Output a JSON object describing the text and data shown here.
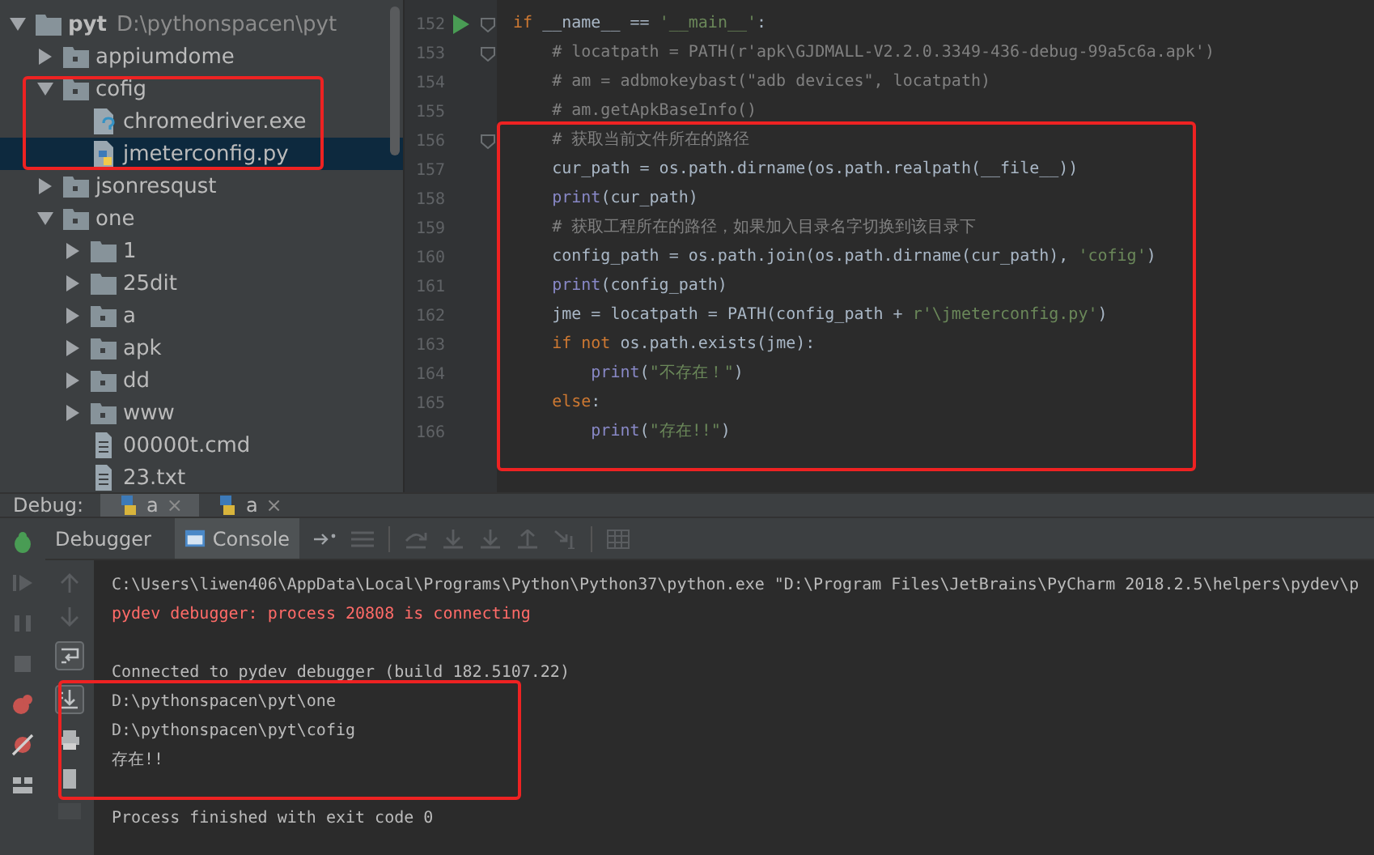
{
  "project_tree": {
    "items": [
      {
        "kind": "folder",
        "label": "pyt",
        "path": "D:\\pythonspacen\\pyt",
        "expanded": true,
        "selected": false,
        "children": [
          {
            "kind": "package",
            "label": "appiumdome",
            "expanded": false,
            "selected": false
          },
          {
            "kind": "package",
            "label": "cofig",
            "expanded": true,
            "selected": false,
            "children": [
              {
                "kind": "file-unknown",
                "label": "chromedriver.exe",
                "selected": false
              },
              {
                "kind": "file-python",
                "label": "jmeterconfig.py",
                "selected": true
              }
            ]
          },
          {
            "kind": "package",
            "label": "jsonresqust",
            "expanded": false,
            "selected": false
          },
          {
            "kind": "package",
            "label": "one",
            "expanded": true,
            "selected": false,
            "children": [
              {
                "kind": "folder",
                "label": "1",
                "expanded": false,
                "selected": false
              },
              {
                "kind": "folder",
                "label": "25dit",
                "expanded": false,
                "selected": false
              },
              {
                "kind": "package",
                "label": "a",
                "expanded": false,
                "selected": false
              },
              {
                "kind": "package",
                "label": "apk",
                "expanded": false,
                "selected": false
              },
              {
                "kind": "package",
                "label": "dd",
                "expanded": false,
                "selected": false
              },
              {
                "kind": "package",
                "label": "www",
                "expanded": false,
                "selected": false
              },
              {
                "kind": "file-text",
                "label": "00000t.cmd",
                "selected": false
              },
              {
                "kind": "file-text",
                "label": "23.txt",
                "selected": false
              }
            ]
          }
        ]
      }
    ]
  },
  "editor": {
    "lines": [
      {
        "number": "152",
        "run_marker": true,
        "fold": true,
        "tokens": [
          {
            "kind": "keyword",
            "text": "if"
          },
          {
            "kind": "plain",
            "text": " __name__ == "
          },
          {
            "kind": "string",
            "text": "'__main__'"
          },
          {
            "kind": "plain",
            "text": ":"
          }
        ]
      },
      {
        "number": "153",
        "run_marker": false,
        "fold": true,
        "tokens": [
          {
            "kind": "comment",
            "text": "    # locatpath = PATH(r'apk\\GJDMALL-V2.2.0.3349-436-debug-99a5c6a.apk')"
          }
        ]
      },
      {
        "number": "154",
        "run_marker": false,
        "fold": false,
        "tokens": [
          {
            "kind": "comment",
            "text": "    # am = adbmokeybast(\"adb devices\", locatpath)"
          }
        ]
      },
      {
        "number": "155",
        "run_marker": false,
        "fold": false,
        "tokens": [
          {
            "kind": "comment",
            "text": "    # am.getApkBaseInfo()"
          }
        ]
      },
      {
        "number": "156",
        "run_marker": false,
        "fold": true,
        "tokens": [
          {
            "kind": "comment",
            "text": "    # 获取当前文件所在的路径"
          }
        ]
      },
      {
        "number": "157",
        "run_marker": false,
        "fold": false,
        "tokens": [
          {
            "kind": "plain",
            "text": "    cur_path = os.path.dirname(os.path.realpath(__file__))"
          }
        ]
      },
      {
        "number": "158",
        "run_marker": false,
        "fold": false,
        "tokens": [
          {
            "kind": "builtin",
            "text": "    print"
          },
          {
            "kind": "plain",
            "text": "(cur_path)"
          }
        ]
      },
      {
        "number": "159",
        "run_marker": false,
        "fold": false,
        "tokens": [
          {
            "kind": "comment",
            "text": "    # 获取工程所在的路径，如果加入目录名字切换到该目录下"
          }
        ]
      },
      {
        "number": "160",
        "run_marker": false,
        "fold": false,
        "tokens": [
          {
            "kind": "plain",
            "text": "    config_path = os.path.join(os.path.dirname(cur_path), "
          },
          {
            "kind": "string",
            "text": "'cofig'"
          },
          {
            "kind": "plain",
            "text": ")"
          }
        ]
      },
      {
        "number": "161",
        "run_marker": false,
        "fold": false,
        "tokens": [
          {
            "kind": "builtin",
            "text": "    print"
          },
          {
            "kind": "plain",
            "text": "(config_path)"
          }
        ]
      },
      {
        "number": "162",
        "run_marker": false,
        "fold": false,
        "tokens": [
          {
            "kind": "plain",
            "text": "    jme = locatpath = PATH(config_path + "
          },
          {
            "kind": "string",
            "text": "r'\\jmeterconfig.py'"
          },
          {
            "kind": "plain",
            "text": ")"
          }
        ]
      },
      {
        "number": "163",
        "run_marker": false,
        "fold": false,
        "tokens": [
          {
            "kind": "keyword",
            "text": "    if not"
          },
          {
            "kind": "plain",
            "text": " os.path.exists(jme):"
          }
        ]
      },
      {
        "number": "164",
        "run_marker": false,
        "fold": false,
        "tokens": [
          {
            "kind": "builtin",
            "text": "        print"
          },
          {
            "kind": "plain",
            "text": "("
          },
          {
            "kind": "string",
            "text": "\"不存在！\""
          },
          {
            "kind": "plain",
            "text": ")"
          }
        ]
      },
      {
        "number": "165",
        "run_marker": false,
        "fold": false,
        "tokens": [
          {
            "kind": "keyword",
            "text": "    else"
          },
          {
            "kind": "plain",
            "text": ":"
          }
        ]
      },
      {
        "number": "166",
        "run_marker": false,
        "fold": false,
        "tokens": [
          {
            "kind": "builtin",
            "text": "        print"
          },
          {
            "kind": "plain",
            "text": "("
          },
          {
            "kind": "string",
            "text": "\"存在!!\""
          },
          {
            "kind": "plain",
            "text": ")"
          }
        ]
      }
    ]
  },
  "debug": {
    "label": "Debug:",
    "tabs": [
      {
        "label": "a",
        "close": "×",
        "selected": true
      },
      {
        "label": "a",
        "close": "×",
        "selected": false
      }
    ],
    "views": [
      {
        "label": "Debugger",
        "selected": false
      },
      {
        "label": "Console",
        "selected": true
      }
    ]
  },
  "console": {
    "blocks": [
      [
        {
          "kind": "plain",
          "text": "C:\\Users\\liwen406\\AppData\\Local\\Programs\\Python\\Python37\\python.exe \"D:\\Program Files\\JetBrains\\PyCharm 2018.2.5\\helpers\\pydev\\p"
        },
        {
          "kind": "error",
          "text": "pydev debugger: process 20808 is connecting"
        }
      ],
      [
        {
          "kind": "plain",
          "text": "Connected to pydev debugger (build 182.5107.22)"
        },
        {
          "kind": "plain",
          "text": "D:\\pythonspacen\\pyt\\one"
        },
        {
          "kind": "plain",
          "text": "D:\\pythonspacen\\pyt\\cofig"
        },
        {
          "kind": "plain",
          "text": "存在!!"
        }
      ],
      [
        {
          "kind": "plain",
          "text": "Process finished with exit code 0"
        }
      ]
    ]
  }
}
